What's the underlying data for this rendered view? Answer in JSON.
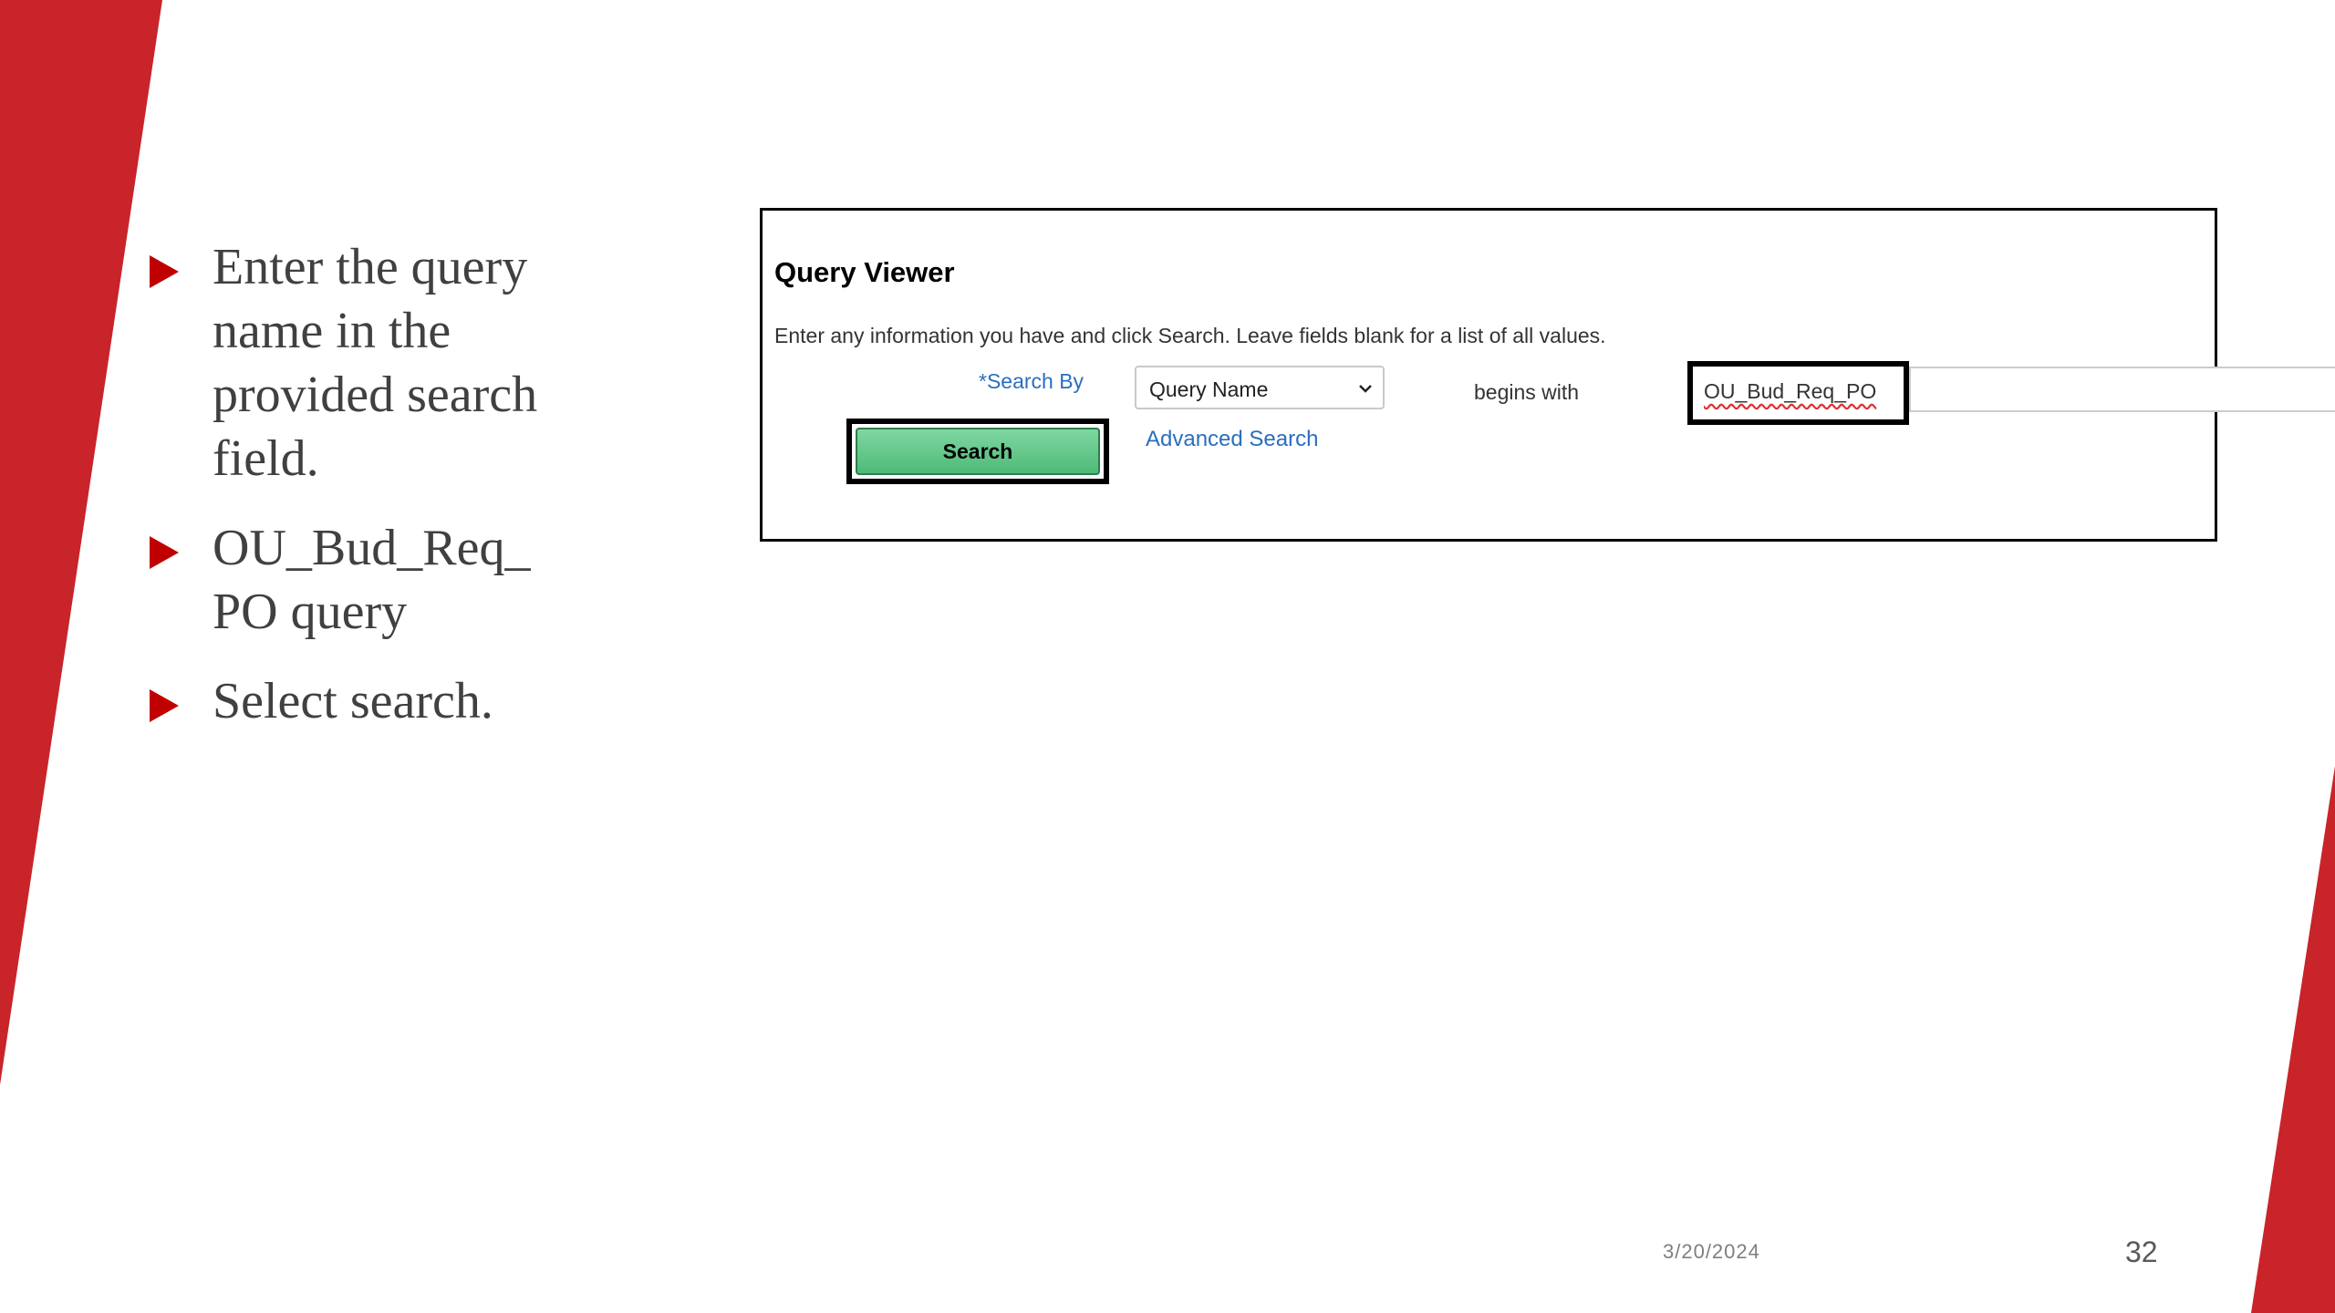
{
  "bullets": [
    "Enter the query name in the provided search field.",
    "OU_Bud_Req_ PO query",
    "Select search."
  ],
  "query_viewer": {
    "title": "Query Viewer",
    "instructions": "Enter any information you have and click Search. Leave fields blank for a list of all values.",
    "search_by_label": "*Search By",
    "search_by_value": "Query Name",
    "operator": "begins with",
    "query_input_value": "OU_Bud_Req_PO",
    "search_button": "Search",
    "advanced_search": "Advanced Search"
  },
  "footer": {
    "date": "3/20/2024",
    "page": "32"
  },
  "colors": {
    "accent": "#c8242a",
    "bullet_arrow": "#c00000",
    "search_button": "#5cc185",
    "link": "#2a6ebf"
  }
}
